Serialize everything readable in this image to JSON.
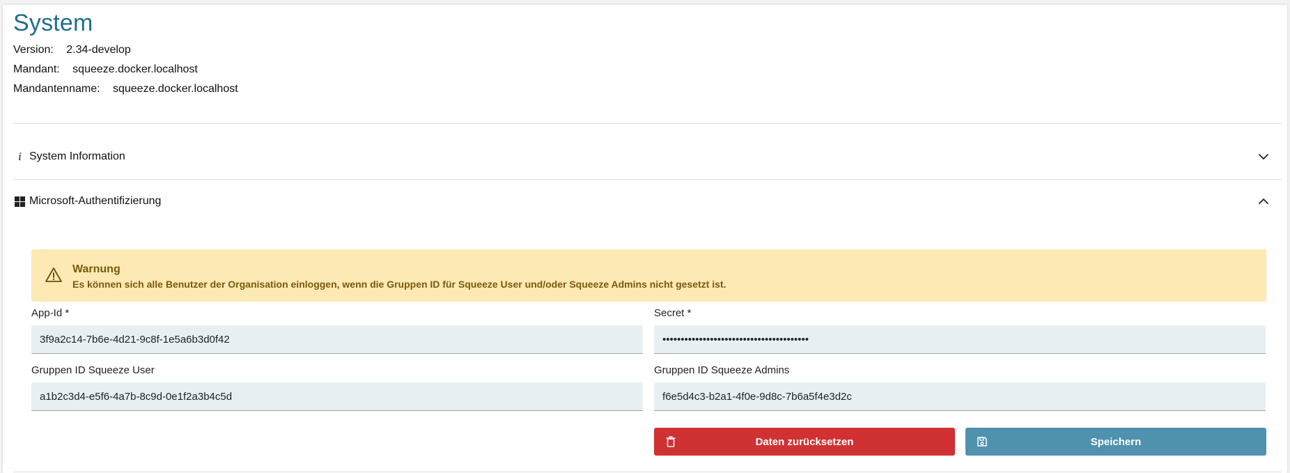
{
  "page": {
    "title": "System"
  },
  "system_info": {
    "version_label": "Version:",
    "version_value": "2.34-develop",
    "mandant_label": "Mandant:",
    "mandant_value": "squeeze.docker.localhost",
    "mandantenname_label": "Mandantenname:",
    "mandantenname_value": "squeeze.docker.localhost"
  },
  "accordions": [
    {
      "label": "System Information",
      "icon": "info-icon",
      "expanded": false
    },
    {
      "label": "Microsoft-Authentifizierung",
      "icon": "windows-icon",
      "expanded": true
    }
  ],
  "warning": {
    "title": "Warnung",
    "text": "Es können sich alle Benutzer der Organisation einloggen, wenn die Gruppen ID für Squeeze User und/oder Squeeze Admins nicht gesetzt ist."
  },
  "form": {
    "app_id_label": "App-Id *",
    "app_id_value": "3f9a2c14-7b6e-4d21-9c8f-1e5a6b3d0f42",
    "secret_label": "Secret *",
    "secret_value": "••••••••••••••••••••••••••••••••••••••••",
    "user_group_label": "Gruppen ID Squeeze User",
    "user_group_value": "a1b2c3d4-e5f6-4a7b-8c9d-0e1f2a3b4c5d",
    "admin_group_label": "Gruppen ID Squeeze Admins",
    "admin_group_value": "f6e5d4c3-b2a1-4f0e-9d8c-7b6a5f4e3d2c"
  },
  "buttons": {
    "reset_label": "Daten zurücksetzen",
    "save_label": "Speichern"
  },
  "colors": {
    "title": "#1e6e8c",
    "warning_bg": "#fde9b4",
    "warning_text": "#7a5a0a",
    "danger": "#d03233",
    "primary": "#4f92ae",
    "field_bg": "#e8eff3"
  }
}
